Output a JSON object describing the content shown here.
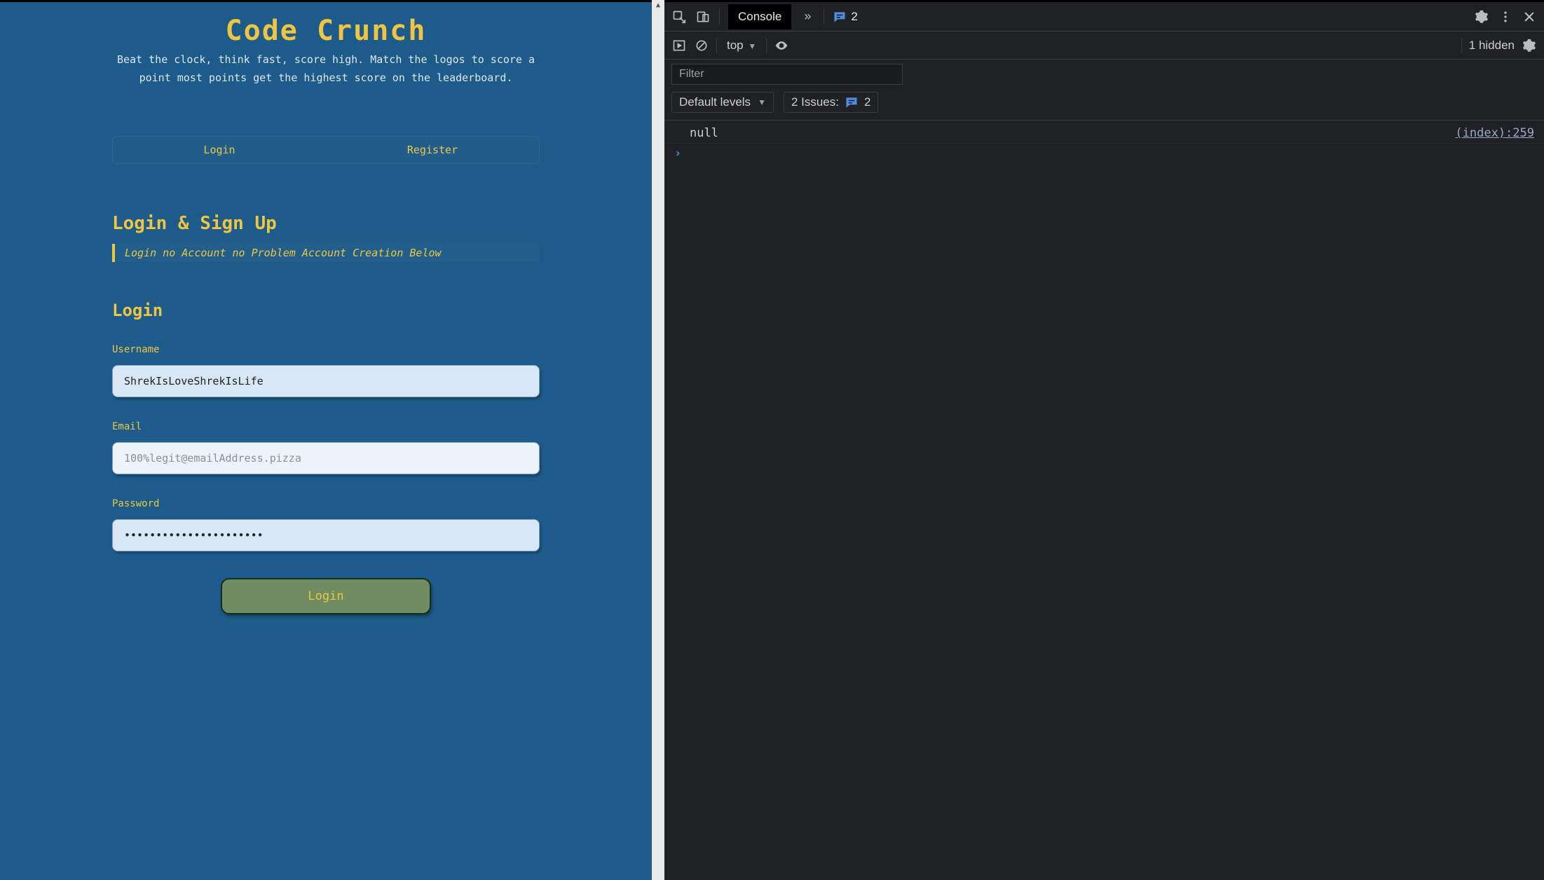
{
  "app": {
    "title": "Code Crunch",
    "tagline": "Beat the clock, think fast, score high. Match the logos to score a point most points get the highest score on the leaderboard.",
    "tabs": {
      "login": "Login",
      "register": "Register"
    },
    "section_heading": "Login & Sign Up",
    "section_quote": "Login no Account no Problem Account Creation Below",
    "form_heading": "Login",
    "fields": {
      "username": {
        "label": "Username",
        "value": "ShrekIsLoveShrekIsLife",
        "placeholder": ""
      },
      "email": {
        "label": "Email",
        "value": "",
        "placeholder": "100%legit@emailAddress.pizza"
      },
      "password": {
        "label": "Password",
        "value": "••••••••••••••••••••••",
        "placeholder": ""
      }
    },
    "submit_label": "Login"
  },
  "devtools": {
    "active_tab": "Console",
    "overflow_symbol": "»",
    "issue_badge_count": "2",
    "context": "top",
    "hidden_text": "1 hidden",
    "filter_placeholder": "Filter",
    "levels_label": "Default levels",
    "issues_label": "2 Issues:",
    "issues_count": "2",
    "logs": [
      {
        "message": "null",
        "source": "(index):259"
      }
    ],
    "prompt": "›"
  }
}
